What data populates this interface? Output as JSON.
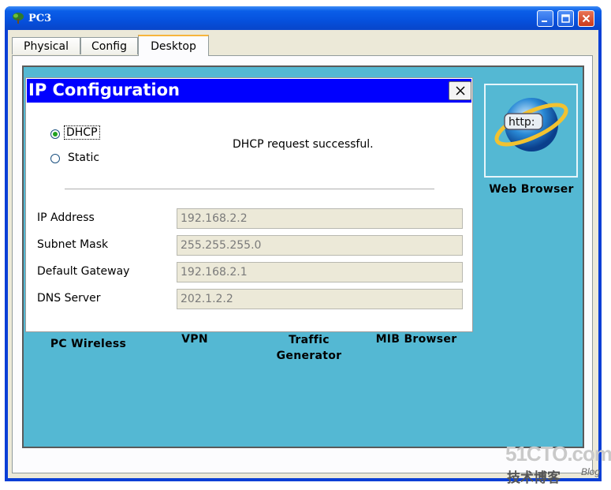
{
  "window": {
    "title": "PC3",
    "icon": "pc-tree-icon",
    "controls": [
      "minimize-icon",
      "maximize-icon",
      "close-icon"
    ]
  },
  "tabs": [
    {
      "label": "Physical",
      "active": false
    },
    {
      "label": "Config",
      "active": false
    },
    {
      "label": "Desktop",
      "active": true
    }
  ],
  "desktop": {
    "apps": [
      {
        "label": "PC Wireless"
      },
      {
        "label": "VPN"
      },
      {
        "label": "Traffic Generator",
        "line1": "Traffic",
        "line2": "Generator"
      },
      {
        "label": "MIB Browser"
      },
      {
        "label": "Web Browser",
        "icon": "web-browser-globe-icon",
        "icon_text": "http:"
      }
    ]
  },
  "dialog": {
    "title": "IP Configuration",
    "close_label": "X",
    "mode_options": [
      {
        "label": "DHCP",
        "selected": true
      },
      {
        "label": "Static",
        "selected": false
      }
    ],
    "status": "DHCP request successful.",
    "fields": [
      {
        "label": "IP Address",
        "value": "192.168.2.2"
      },
      {
        "label": "Subnet Mask",
        "value": "255.255.255.0"
      },
      {
        "label": "Default Gateway",
        "value": "192.168.2.1"
      },
      {
        "label": "DNS Server",
        "value": "202.1.2.2"
      }
    ]
  },
  "watermark": {
    "site": "51CTO.com",
    "tagline": "技术博客",
    "blog": "Blog"
  },
  "colors": {
    "titlebar": "#0651dd",
    "desktop_bg": "#54b8d3",
    "dialog_title_bg": "#0000ff",
    "radio_selected": "#21a121",
    "tab_active_accent": "#f7b53c"
  }
}
